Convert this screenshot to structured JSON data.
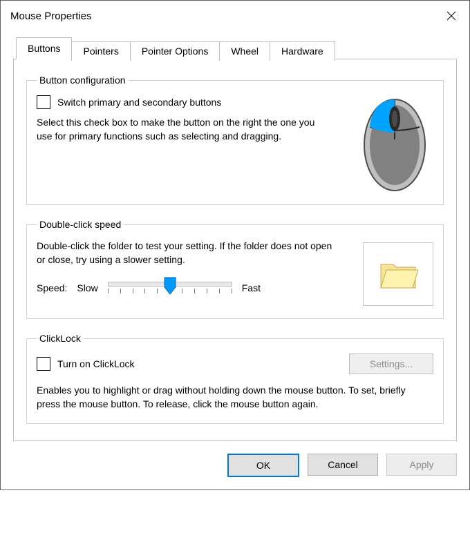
{
  "window": {
    "title": "Mouse Properties"
  },
  "tabs": [
    {
      "label": "Buttons",
      "active": true
    },
    {
      "label": "Pointers",
      "active": false
    },
    {
      "label": "Pointer Options",
      "active": false
    },
    {
      "label": "Wheel",
      "active": false
    },
    {
      "label": "Hardware",
      "active": false
    }
  ],
  "button_config": {
    "legend": "Button configuration",
    "checkbox_label": "Switch primary and secondary buttons",
    "checked": false,
    "description": "Select this check box to make the button on the right the one you use for primary functions such as selecting and dragging."
  },
  "double_click": {
    "legend": "Double-click speed",
    "description": "Double-click the folder to test your setting. If the folder does not open or close, try using a slower setting.",
    "speed_label": "Speed:",
    "slow_label": "Slow",
    "fast_label": "Fast",
    "slider_value": 5,
    "slider_min": 0,
    "slider_max": 10
  },
  "clicklock": {
    "legend": "ClickLock",
    "checkbox_label": "Turn on ClickLock",
    "checked": false,
    "settings_button": "Settings...",
    "description": "Enables you to highlight or drag without holding down the mouse button. To set, briefly press the mouse button. To release, click the mouse button again."
  },
  "buttons": {
    "ok": "OK",
    "cancel": "Cancel",
    "apply": "Apply"
  }
}
